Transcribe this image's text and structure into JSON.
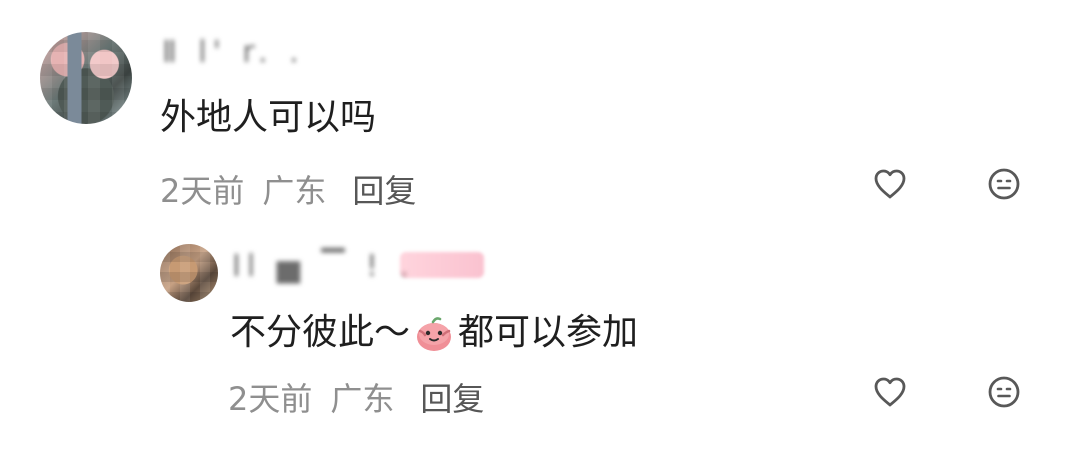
{
  "main_comment": {
    "username_display": "Ⅱ l' r. .",
    "text": "外地人可以吗",
    "time": "2天前",
    "location": "广东",
    "reply_label": "回复"
  },
  "reply_comment": {
    "username_display": "Il ▅ ▔ ! .",
    "text_before": "不分彼此～",
    "text_after": "都可以参加",
    "time": "2天前",
    "location": "广东",
    "reply_label": "回复"
  },
  "icons": {
    "like": "heart-icon",
    "dislike": "neutral-face-icon",
    "emoji": "red-blob-emoji"
  },
  "colors": {
    "meta_text": "#8f8f8f",
    "reply_text": "#575757",
    "badge_pink": "#f4a1b6"
  }
}
